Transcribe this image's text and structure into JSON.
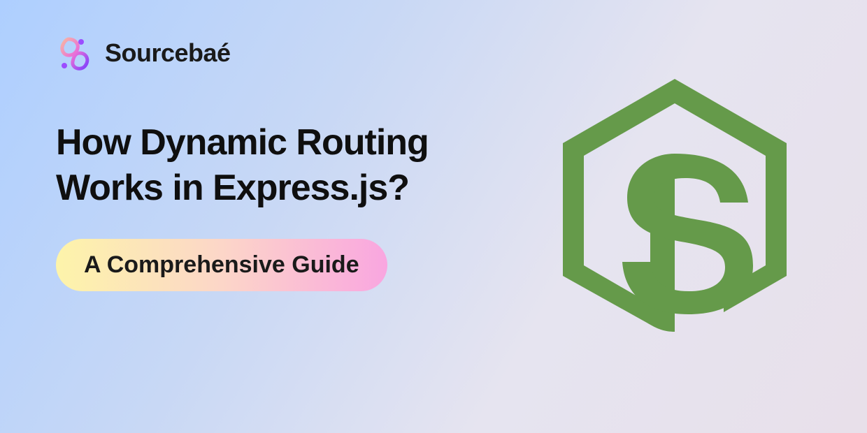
{
  "brand": {
    "name": "Sourcebaé"
  },
  "headline": {
    "line1": "How Dynamic Routing",
    "line2": "Works in Express.js?"
  },
  "pill": {
    "label": "A Comprehensive Guide"
  },
  "colors": {
    "nodejs_green": "#659a4a",
    "text": "#0f0f0f"
  }
}
